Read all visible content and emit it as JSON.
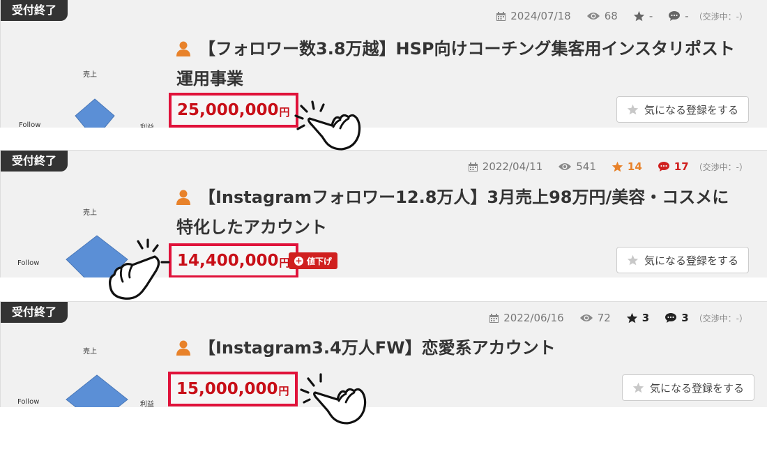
{
  "listings": [
    {
      "badge": "受付終了",
      "date": "2024/07/18",
      "views": "68",
      "stars": "-",
      "comments": "-",
      "negotiating": "（交渉中：-）",
      "title": "【フォロワー数3.8万越】HSP向けコーチング集客用インスタリポスト運用事業",
      "price": "25,000,000",
      "yen": "円",
      "fav_label": "気になる登録をする",
      "chart_labels": {
        "top": "売上",
        "left": "Follow",
        "right": "利益"
      }
    },
    {
      "badge": "受付終了",
      "date": "2022/04/11",
      "views": "541",
      "stars": "14",
      "comments": "17",
      "negotiating": "（交渉中：-）",
      "title": "【Instagramフォロワー12.8万人】3月売上98万円/美容・コスメに特化したアカウント",
      "price": "14,400,000",
      "yen": "円",
      "price_down": "値下げ",
      "fav_label": "気になる登録をする",
      "chart_labels": {
        "top": "売上",
        "left": "Follow"
      }
    },
    {
      "badge": "受付終了",
      "date": "2022/06/16",
      "views": "72",
      "stars": "3",
      "comments": "3",
      "negotiating": "（交渉中：-）",
      "title": "【Instagram3.4万人FW】恋愛系アカウント",
      "price": "15,000,000",
      "yen": "円",
      "fav_label": "気になる登録をする",
      "chart_labels": {
        "top": "売上",
        "left": "Follow",
        "right": "利益"
      }
    }
  ],
  "colors": {
    "accent_red": "#e0123a",
    "price_red": "#c80f18",
    "user_orange": "#e8822a",
    "chart_blue": "#5b8fd6",
    "badge_dark": "#333333"
  },
  "icons": [
    "calendar-icon",
    "eye-icon",
    "star-icon",
    "comment-icon",
    "user-icon",
    "pointing-hand-icon",
    "plus-circle-icon"
  ]
}
